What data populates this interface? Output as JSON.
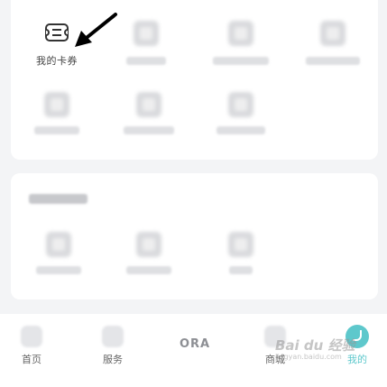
{
  "top_grid": {
    "first_item_label": "我的卡券"
  },
  "section2": {
    "title": "",
    "items": []
  },
  "tabbar": {
    "home": "首页",
    "service": "服务",
    "logo": "ORA",
    "mall": "商城",
    "me": "我的",
    "accent_color": "#5ec8cc"
  },
  "watermark": {
    "brand": "Bai du 经验",
    "domain": "jingyan.baidu.com"
  },
  "icons": {
    "coupon": "ticket-icon",
    "arrow": "pointer-arrow-icon"
  }
}
